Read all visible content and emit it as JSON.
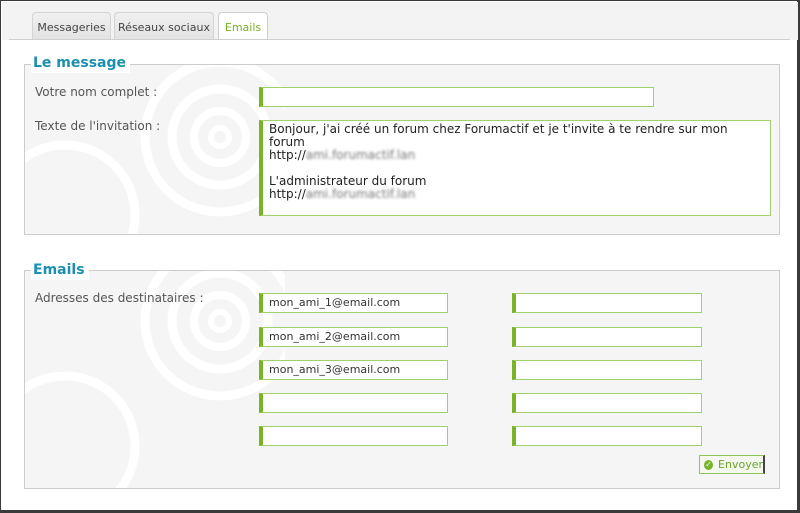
{
  "tabs": [
    {
      "label": "Messageries"
    },
    {
      "label": "Réseaux sociaux"
    },
    {
      "label": "Emails"
    }
  ],
  "message_section": {
    "legend": "Le message",
    "name_label": "Votre nom complet :",
    "name_value": "",
    "invitation_label": "Texte de l'invitation :",
    "invitation_line1": "Bonjour, j'ai créé un forum chez Forumactif et je t'invite à te rendre sur mon forum",
    "invitation_line2_prefix": "http://",
    "invitation_line2_blurred": "ami.forumactif.lan",
    "invitation_line4": "L'administrateur du forum",
    "invitation_line5_prefix": "http://",
    "invitation_line5_blurred": "ami.forumactif.lan"
  },
  "emails_section": {
    "legend": "Emails",
    "recipients_label": "Adresses des destinataires :",
    "left_column": [
      "mon_ami_1@email.com",
      "mon_ami_2@email.com",
      "mon_ami_3@email.com",
      "",
      ""
    ],
    "right_column": [
      "",
      "",
      "",
      "",
      ""
    ],
    "send_label": "Envoyer"
  },
  "colors": {
    "accent_green": "#78b328",
    "legend_blue": "#1a8fb0"
  }
}
